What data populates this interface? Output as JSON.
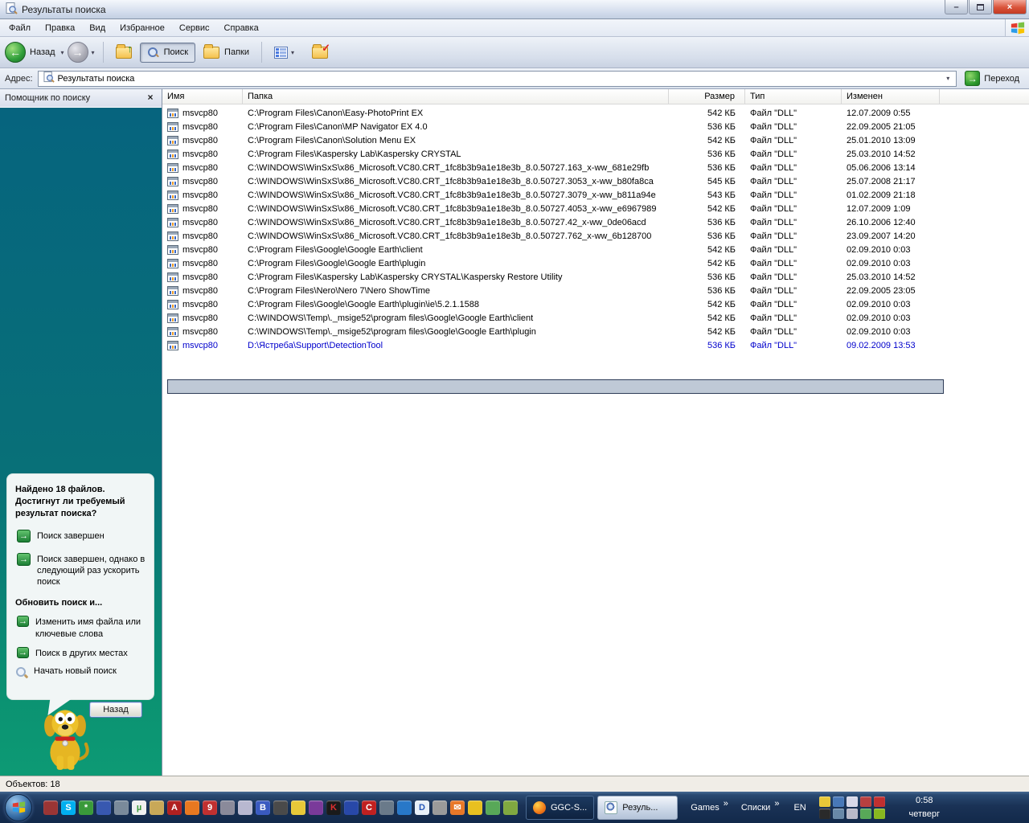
{
  "window": {
    "title": "Результаты поиска"
  },
  "titlebar": {
    "minimize": "–",
    "close_glyph": "×"
  },
  "menu": {
    "items": [
      {
        "label": "Файл"
      },
      {
        "label": "Правка"
      },
      {
        "label": "Вид"
      },
      {
        "label": "Избранное"
      },
      {
        "label": "Сервис"
      },
      {
        "label": "Справка"
      }
    ]
  },
  "toolbar": {
    "back_label": "Назад",
    "search_label": "Поиск",
    "folders_label": "Папки",
    "back_glyph": "←",
    "forward_glyph": "→",
    "up_glyph": "↑",
    "check_glyph": "✓",
    "caret": "▾"
  },
  "addressbar": {
    "label": "Адрес:",
    "value": "Результаты поиска",
    "go_label": "Переход",
    "go_glyph": "→",
    "caret": "▾"
  },
  "sidebar": {
    "title": "Помощник по поиску",
    "close_glyph": "×",
    "found_heading": "Найдено 18 файлов. Достигнут ли требуемый результат поиска?",
    "options": [
      {
        "label": "Поиск завершен"
      },
      {
        "label": "Поиск завершен, однако в следующий раз ускорить поиск"
      }
    ],
    "refine_heading": "Обновить поиск и...",
    "refine_options": [
      {
        "label": "Изменить имя файла или ключевые слова"
      },
      {
        "label": "Поиск в других местах"
      }
    ],
    "new_search": "Начать новый поиск",
    "back_button": "Назад",
    "arrow_glyph": "→"
  },
  "list": {
    "columns": {
      "name": "Имя",
      "folder": "Папка",
      "size": "Размер",
      "type": "Тип",
      "modified": "Изменен"
    },
    "files": [
      {
        "name": "msvcp80",
        "folder": "C:\\Program Files\\Canon\\Easy-PhotoPrint EX",
        "size": "542 КБ",
        "type": "Файл \"DLL\"",
        "modified": "12.07.2009 0:55"
      },
      {
        "name": "msvcp80",
        "folder": "C:\\Program Files\\Canon\\MP Navigator EX 4.0",
        "size": "536 КБ",
        "type": "Файл \"DLL\"",
        "modified": "22.09.2005 21:05"
      },
      {
        "name": "msvcp80",
        "folder": "C:\\Program Files\\Canon\\Solution Menu EX",
        "size": "542 КБ",
        "type": "Файл \"DLL\"",
        "modified": "25.01.2010 13:09"
      },
      {
        "name": "msvcp80",
        "folder": "C:\\Program Files\\Kaspersky Lab\\Kaspersky CRYSTAL",
        "size": "536 КБ",
        "type": "Файл \"DLL\"",
        "modified": "25.03.2010 14:52"
      },
      {
        "name": "msvcp80",
        "folder": "C:\\WINDOWS\\WinSxS\\x86_Microsoft.VC80.CRT_1fc8b3b9a1e18e3b_8.0.50727.163_x-ww_681e29fb",
        "size": "536 КБ",
        "type": "Файл \"DLL\"",
        "modified": "05.06.2006 13:14"
      },
      {
        "name": "msvcp80",
        "folder": "C:\\WINDOWS\\WinSxS\\x86_Microsoft.VC80.CRT_1fc8b3b9a1e18e3b_8.0.50727.3053_x-ww_b80fa8ca",
        "size": "545 КБ",
        "type": "Файл \"DLL\"",
        "modified": "25.07.2008 21:17"
      },
      {
        "name": "msvcp80",
        "folder": "C:\\WINDOWS\\WinSxS\\x86_Microsoft.VC80.CRT_1fc8b3b9a1e18e3b_8.0.50727.3079_x-ww_b811a94e",
        "size": "543 КБ",
        "type": "Файл \"DLL\"",
        "modified": "01.02.2009 21:18"
      },
      {
        "name": "msvcp80",
        "folder": "C:\\WINDOWS\\WinSxS\\x86_Microsoft.VC80.CRT_1fc8b3b9a1e18e3b_8.0.50727.4053_x-ww_e6967989",
        "size": "542 КБ",
        "type": "Файл \"DLL\"",
        "modified": "12.07.2009 1:09"
      },
      {
        "name": "msvcp80",
        "folder": "C:\\WINDOWS\\WinSxS\\x86_Microsoft.VC80.CRT_1fc8b3b9a1e18e3b_8.0.50727.42_x-ww_0de06acd",
        "size": "536 КБ",
        "type": "Файл \"DLL\"",
        "modified": "26.10.2006 12:40"
      },
      {
        "name": "msvcp80",
        "folder": "C:\\WINDOWS\\WinSxS\\x86_Microsoft.VC80.CRT_1fc8b3b9a1e18e3b_8.0.50727.762_x-ww_6b128700",
        "size": "536 КБ",
        "type": "Файл \"DLL\"",
        "modified": "23.09.2007 14:20"
      },
      {
        "name": "msvcp80",
        "folder": "C:\\Program Files\\Google\\Google Earth\\client",
        "size": "542 КБ",
        "type": "Файл \"DLL\"",
        "modified": "02.09.2010 0:03"
      },
      {
        "name": "msvcp80",
        "folder": "C:\\Program Files\\Google\\Google Earth\\plugin",
        "size": "542 КБ",
        "type": "Файл \"DLL\"",
        "modified": "02.09.2010 0:03"
      },
      {
        "name": "msvcp80",
        "folder": "C:\\Program Files\\Kaspersky Lab\\Kaspersky CRYSTAL\\Kaspersky Restore Utility",
        "size": "536 КБ",
        "type": "Файл \"DLL\"",
        "modified": "25.03.2010 14:52"
      },
      {
        "name": "msvcp80",
        "folder": "C:\\Program Files\\Nero\\Nero 7\\Nero ShowTime",
        "size": "536 КБ",
        "type": "Файл \"DLL\"",
        "modified": "22.09.2005 23:05"
      },
      {
        "name": "msvcp80",
        "folder": "C:\\Program Files\\Google\\Google Earth\\plugin\\ie\\5.2.1.1588",
        "size": "542 КБ",
        "type": "Файл \"DLL\"",
        "modified": "02.09.2010 0:03"
      },
      {
        "name": "msvcp80",
        "folder": "C:\\WINDOWS\\Temp\\._msige52\\program files\\Google\\Google Earth\\client",
        "size": "542 КБ",
        "type": "Файл \"DLL\"",
        "modified": "02.09.2010 0:03"
      },
      {
        "name": "msvcp80",
        "folder": "C:\\WINDOWS\\Temp\\._msige52\\program files\\Google\\Google Earth\\plugin",
        "size": "542 КБ",
        "type": "Файл \"DLL\"",
        "modified": "02.09.2010 0:03"
      },
      {
        "name": "msvcp80",
        "folder": "D:\\Ястреба\\Support\\DetectionTool",
        "size": "536 КБ",
        "type": "Файл \"DLL\"",
        "modified": "09.02.2009 13:53",
        "highlighted": true
      }
    ]
  },
  "statusbar": {
    "text": "Объектов: 18"
  },
  "taskbar": {
    "quicklaunch": [
      {
        "name": "media-player-red-icon",
        "bg": "#9a3535",
        "glyph": ""
      },
      {
        "name": "skype-icon",
        "bg": "#00aff0",
        "glyph": "S"
      },
      {
        "name": "fraps-icon",
        "bg": "#3a9a3a",
        "glyph": "*"
      },
      {
        "name": "save-floppy-icon",
        "bg": "#3858b0",
        "glyph": ""
      },
      {
        "name": "computer-tools-icon",
        "bg": "#7a8a9a",
        "glyph": ""
      },
      {
        "name": "utorrent-icon",
        "bg": "#f0f0f0",
        "fg": "#3a9a3a",
        "glyph": "µ"
      },
      {
        "name": "installer-hand-icon",
        "bg": "#c8a858",
        "glyph": ""
      },
      {
        "name": "adobe-reader-icon",
        "bg": "#b02020",
        "glyph": "A"
      },
      {
        "name": "firefox-icon",
        "bg": "#e87820",
        "glyph": ""
      },
      {
        "name": "guitar-app-icon",
        "bg": "#c03030",
        "glyph": "9"
      },
      {
        "name": "lightning-app-icon",
        "bg": "#8a8a9a",
        "glyph": ""
      },
      {
        "name": "cd-burner-icon",
        "bg": "#b8b8d0",
        "glyph": ""
      },
      {
        "name": "bluetooth-icon",
        "bg": "#3a5ac0",
        "glyph": "B"
      },
      {
        "name": "movie-reel-icon",
        "bg": "#4a4a4a",
        "glyph": ""
      },
      {
        "name": "dictionary-book-icon",
        "bg": "#e8c838",
        "glyph": ""
      },
      {
        "name": "globe-purple-icon",
        "bg": "#7a3a9a",
        "glyph": ""
      },
      {
        "name": "kaspersky-icon",
        "bg": "#1a1a1a",
        "fg": "#e03030",
        "glyph": "K"
      },
      {
        "name": "flashget-icon",
        "bg": "#2848a8",
        "glyph": ""
      },
      {
        "name": "comodo-icon",
        "bg": "#c02020",
        "glyph": "C"
      },
      {
        "name": "video-editor-icon",
        "bg": "#6a7a8a",
        "glyph": ""
      },
      {
        "name": "google-earth-icon",
        "bg": "#2878c8",
        "glyph": ""
      },
      {
        "name": "daemon-tools-icon",
        "bg": "#e8f0f8",
        "fg": "#2858b8",
        "glyph": "D"
      },
      {
        "name": "archive-box-icon",
        "bg": "#9a9a9a",
        "glyph": ""
      },
      {
        "name": "mail-notifier-icon",
        "bg": "#e87828",
        "glyph": "✉"
      },
      {
        "name": "dcpp-icon",
        "bg": "#e8c020",
        "glyph": ""
      },
      {
        "name": "phone-sync-icon",
        "bg": "#58a858",
        "glyph": ""
      },
      {
        "name": "webmoney-icon",
        "bg": "#80a840",
        "glyph": ""
      }
    ],
    "buttons": [
      {
        "label": "GGC-S...",
        "icon": "firefox",
        "dark": true
      },
      {
        "label": "Резуль...",
        "icon": "search",
        "active": true
      }
    ],
    "toolbars": [
      {
        "label": "Games"
      },
      {
        "label": "Списки"
      }
    ],
    "chevron": "»",
    "language": "EN",
    "tray_row1": [
      {
        "name": "clock-tray-icon",
        "bg": "#e8c838"
      },
      {
        "name": "network-monitors-icon",
        "bg": "#4878b8"
      },
      {
        "name": "updater-tray-icon",
        "bg": "#d8d8e8"
      },
      {
        "name": "network-error-icon",
        "bg": "#b84040"
      },
      {
        "name": "antivirus-bird-icon",
        "bg": "#c03030"
      }
    ],
    "tray_row2": [
      {
        "name": "g1-tray-icon",
        "bg": "#2a2a2a"
      },
      {
        "name": "settings-gear-icon",
        "bg": "#6888a8"
      },
      {
        "name": "volume-icon",
        "bg": "#b8b8c8"
      },
      {
        "name": "keyboard-layout-icon",
        "bg": "#58a858"
      },
      {
        "name": "nvidia-icon",
        "bg": "#88b820"
      }
    ],
    "clock": {
      "time": "0:58",
      "day": "четверг"
    }
  }
}
